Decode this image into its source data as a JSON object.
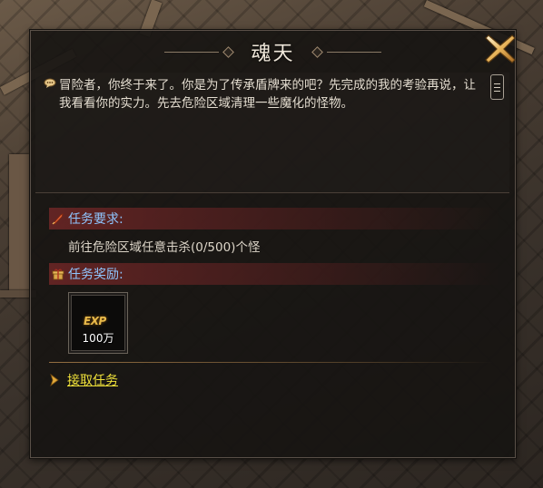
{
  "dialog": {
    "title": "魂天",
    "story": "冒险者，你终于来了。你是为了传承盾牌来的吧？先完成的我的考验再说，让我看看你的实力。先去危险区域清理一些魔化的怪物。"
  },
  "requirement": {
    "label": "任务要求:",
    "text": "前往危险区域任意击杀(0/500)个怪"
  },
  "reward": {
    "label": "任务奖励:",
    "item_icon_text": "EXP",
    "item_amount": "100万"
  },
  "actions": {
    "accept_label": "接取任务"
  },
  "colors": {
    "section_label": "#8fc6ff",
    "accept_link": "#f0e23a",
    "header_bar": "#6e2626"
  }
}
